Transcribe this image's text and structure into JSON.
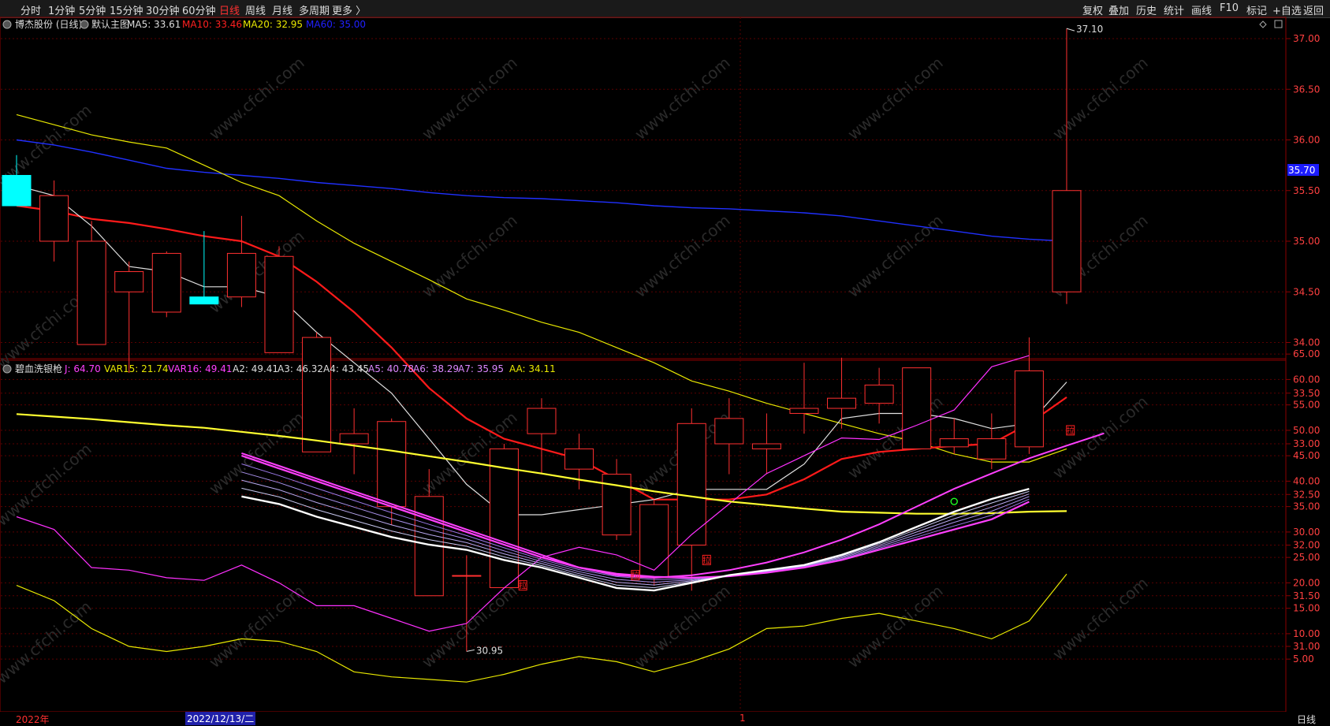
{
  "toolbar": {
    "periods": [
      "分时",
      "1分钟",
      "5分钟",
      "15分钟",
      "30分钟",
      "60分钟",
      "日线",
      "周线",
      "月线",
      "多周期",
      "更多 〉"
    ],
    "active_period": "日线",
    "right_buttons": [
      "复权",
      "叠加",
      "历史",
      "统计",
      "画线",
      "F10",
      "标记",
      "+自选",
      "返回"
    ]
  },
  "main_panel": {
    "title": "博杰股份 (日线)",
    "template": "默认主图",
    "ma_labels": [
      {
        "text": "MA5: 33.61",
        "color": "#dddddd"
      },
      {
        "text": "MA10: 33.46",
        "color": "#ff2020"
      },
      {
        "text": "MA20: 32.95",
        "color": "#e8e800"
      },
      {
        "text": "MA60: 35.00",
        "color": "#2020ff"
      }
    ],
    "high_marker": "37.10",
    "low_marker": "30.95",
    "price_tag": "35.70",
    "y_ticks": [
      "37.00",
      "36.50",
      "36.00",
      "35.50",
      "35.00",
      "34.50",
      "34.00",
      "33.50",
      "33.00",
      "32.50",
      "32.00",
      "31.50",
      "31.00"
    ]
  },
  "indicator_panel": {
    "title": "碧血洗银枪",
    "labels": [
      {
        "text": "J: 64.70",
        "color": "#ff40ff"
      },
      {
        "text": "VAR15: 21.74",
        "color": "#e8e800"
      },
      {
        "text": "VAR16: 49.41",
        "color": "#ff40ff"
      },
      {
        "text": "A2: 49.41",
        "color": "#dddddd"
      },
      {
        "text": "A3: 46.32",
        "color": "#dddddd"
      },
      {
        "text": "A4: 43.45",
        "color": "#dddddd"
      },
      {
        "text": "A5: 40.78",
        "color": "#dd88ff"
      },
      {
        "text": "A6: 38.29",
        "color": "#dd88ff"
      },
      {
        "text": "A7: 35.95",
        "color": "#dd88ff"
      },
      {
        "text": "AA: 34.11",
        "color": "#e8e800"
      }
    ],
    "y_ticks": [
      "65.00",
      "60.00",
      "55.00",
      "50.00",
      "45.00",
      "40.00",
      "35.00",
      "30.00",
      "25.00",
      "20.00",
      "15.00",
      "10.00",
      "5.00"
    ],
    "signal_char": "拉"
  },
  "status": {
    "year_label": "2022年",
    "cursor_date": "2022/12/13/二",
    "month_mark": "1",
    "period_label": "日线"
  },
  "watermark": "www.cfchi.com",
  "chart_data": {
    "type": "candlestick",
    "candles": [
      {
        "o": 35.65,
        "h": 35.85,
        "l": 35.35,
        "c": 35.35
      },
      {
        "o": 35.0,
        "h": 35.6,
        "l": 34.8,
        "c": 35.45
      },
      {
        "o": 33.98,
        "h": 35.2,
        "l": 33.98,
        "c": 35.0
      },
      {
        "o": 34.5,
        "h": 34.8,
        "l": 33.7,
        "c": 34.7
      },
      {
        "o": 34.3,
        "h": 34.9,
        "l": 34.25,
        "c": 34.88
      },
      {
        "o": 34.45,
        "h": 35.1,
        "l": 34.4,
        "c": 34.38
      },
      {
        "o": 34.45,
        "h": 35.25,
        "l": 34.35,
        "c": 34.88
      },
      {
        "o": 33.9,
        "h": 34.95,
        "l": 33.9,
        "c": 34.85
      },
      {
        "o": 32.92,
        "h": 34.1,
        "l": 32.92,
        "c": 34.05
      },
      {
        "o": 33.0,
        "h": 33.35,
        "l": 32.7,
        "c": 33.1
      },
      {
        "o": 32.38,
        "h": 33.25,
        "l": 32.2,
        "c": 33.22
      },
      {
        "o": 31.5,
        "h": 32.75,
        "l": 31.5,
        "c": 32.48
      },
      {
        "o": 31.7,
        "h": 31.9,
        "l": 30.95,
        "c": 31.7
      },
      {
        "o": 31.58,
        "h": 33.0,
        "l": 31.58,
        "c": 32.95
      },
      {
        "o": 33.1,
        "h": 33.45,
        "l": 32.7,
        "c": 33.35
      },
      {
        "o": 32.75,
        "h": 33.1,
        "l": 32.55,
        "c": 32.95
      },
      {
        "o": 32.1,
        "h": 32.85,
        "l": 32.05,
        "c": 32.7
      },
      {
        "o": 31.68,
        "h": 32.45,
        "l": 31.6,
        "c": 32.4
      },
      {
        "o": 32.0,
        "h": 33.35,
        "l": 31.55,
        "c": 33.2
      },
      {
        "o": 33.0,
        "h": 33.45,
        "l": 32.7,
        "c": 33.25
      },
      {
        "o": 32.95,
        "h": 33.3,
        "l": 32.7,
        "c": 33.0
      },
      {
        "o": 33.3,
        "h": 33.8,
        "l": 33.1,
        "c": 33.35
      },
      {
        "o": 33.35,
        "h": 33.85,
        "l": 33.15,
        "c": 33.45
      },
      {
        "o": 33.4,
        "h": 33.75,
        "l": 33.2,
        "c": 33.58
      },
      {
        "o": 32.95,
        "h": 33.75,
        "l": 32.95,
        "c": 33.75
      },
      {
        "o": 32.97,
        "h": 33.25,
        "l": 32.9,
        "c": 33.05
      },
      {
        "o": 32.85,
        "h": 33.3,
        "l": 32.75,
        "c": 33.05
      },
      {
        "o": 32.97,
        "h": 34.05,
        "l": 32.9,
        "c": 33.72
      },
      {
        "o": 34.5,
        "h": 37.1,
        "l": 34.38,
        "c": 35.5
      }
    ],
    "ma5": [
      35.55,
      35.45,
      35.15,
      34.75,
      34.7,
      34.55,
      34.55,
      34.45,
      34.1,
      33.8,
      33.5,
      33.05,
      32.6,
      32.3,
      32.3,
      32.35,
      32.4,
      32.45,
      32.55,
      32.55,
      32.55,
      32.8,
      33.25,
      33.3,
      33.3,
      33.25,
      33.15,
      33.2,
      33.61
    ],
    "ma10": [
      35.35,
      35.3,
      35.22,
      35.18,
      35.12,
      35.05,
      35.0,
      34.85,
      34.6,
      34.3,
      33.95,
      33.55,
      33.25,
      33.05,
      32.95,
      32.85,
      32.65,
      32.45,
      32.45,
      32.45,
      32.5,
      32.65,
      32.85,
      32.92,
      32.95,
      32.98,
      33.0,
      33.2,
      33.46
    ],
    "ma20": [
      36.25,
      36.15,
      36.05,
      35.98,
      35.92,
      35.75,
      35.58,
      35.45,
      35.2,
      34.98,
      34.8,
      34.62,
      34.43,
      34.32,
      34.2,
      34.1,
      33.95,
      33.8,
      33.62,
      33.52,
      33.4,
      33.3,
      33.2,
      33.1,
      33.02,
      32.9,
      32.82,
      32.82,
      32.95
    ],
    "ma60": [
      36.0,
      35.95,
      35.88,
      35.8,
      35.72,
      35.68,
      35.65,
      35.62,
      35.58,
      35.55,
      35.52,
      35.48,
      35.45,
      35.43,
      35.42,
      35.4,
      35.38,
      35.35,
      35.33,
      35.32,
      35.3,
      35.28,
      35.25,
      35.2,
      35.15,
      35.1,
      35.05,
      35.02,
      35.0
    ],
    "ind": {
      "J": [
        33.0,
        30.5,
        23.0,
        22.5,
        21.0,
        20.5,
        23.5,
        20.0,
        15.5,
        15.5,
        13.0,
        10.5,
        12.0,
        19.0,
        25.0,
        27.0,
        25.5,
        22.5,
        29.5,
        35.5,
        41.5,
        45.0,
        48.5,
        48.2,
        51.0,
        54.0,
        62.5,
        64.7
      ],
      "VAR15": [
        19.5,
        16.5,
        11.0,
        7.5,
        6.5,
        7.5,
        9.0,
        8.5,
        6.5,
        2.5,
        1.5,
        1.0,
        0.5,
        2.0,
        4.0,
        5.5,
        4.5,
        2.5,
        4.5,
        7.0,
        11.0,
        11.5,
        13.0,
        14.0,
        12.5,
        11.0,
        9.0,
        12.5,
        21.74
      ],
      "AA": [
        53.2,
        52.7,
        52.2,
        51.6,
        51.0,
        50.5,
        49.7,
        48.9,
        48.0,
        47.0,
        46.0,
        44.9,
        43.8,
        42.6,
        41.5,
        40.3,
        39.2,
        38.0,
        37.0,
        36.0,
        35.3,
        34.6,
        34.0,
        33.8,
        33.6,
        33.6,
        33.7,
        34.0,
        34.11
      ],
      "VAR16": [
        45.5,
        43.0,
        40.5,
        38.0,
        35.5,
        33.0,
        30.5,
        28.0,
        25.5,
        23.0,
        21.5,
        21.0,
        21.5,
        22.5,
        24.0,
        26.0,
        28.5,
        31.5,
        35.0,
        38.5,
        41.5,
        44.5,
        47.0,
        49.41
      ],
      "A2": [
        37.0,
        35.5,
        33.0,
        31.0,
        29.0,
        27.5,
        26.5,
        24.5,
        23.0,
        21.0,
        19.0,
        18.5,
        20.0,
        21.5,
        22.5,
        23.5,
        25.5,
        28.0,
        31.0,
        34.0,
        36.5,
        38.5,
        41.0,
        43.5,
        46.32
      ],
      "A7": [
        45.0,
        42.5,
        40.0,
        37.5,
        35.0,
        32.5,
        30.0,
        27.5,
        25.0,
        23.0,
        21.8,
        21.2,
        21.0,
        21.3,
        22.0,
        23.0,
        24.5,
        26.5,
        28.5,
        30.5,
        32.5,
        35.95
      ]
    }
  }
}
